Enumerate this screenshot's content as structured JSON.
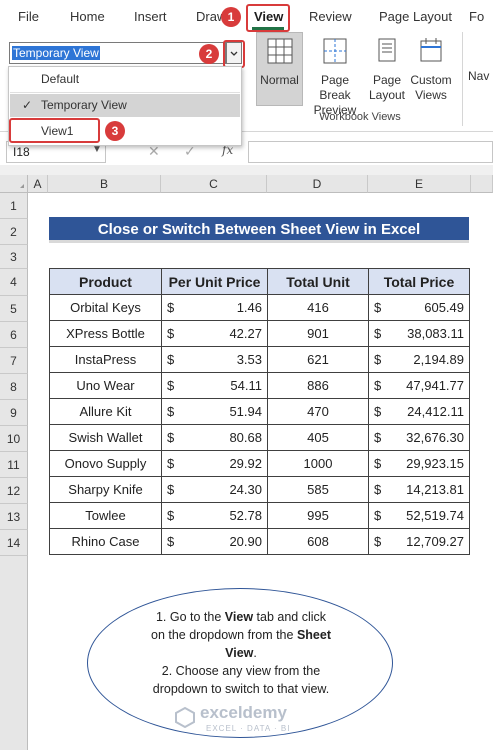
{
  "tabs": [
    "File",
    "Home",
    "Insert",
    "Draw",
    "View",
    "Review",
    "Page Layout",
    "Fo"
  ],
  "active_tab": "View",
  "ribbon": {
    "view_selector_value": "Temporary View",
    "buttons": [
      {
        "label1": "Normal",
        "label2": "",
        "icon": "normal-view-icon"
      },
      {
        "label1": "Page Break",
        "label2": "Preview",
        "icon": "page-break-preview-icon"
      },
      {
        "label1": "Page",
        "label2": "Layout",
        "icon": "page-layout-icon"
      },
      {
        "label1": "Custom",
        "label2": "Views",
        "icon": "custom-views-icon"
      },
      {
        "label1": "Nav",
        "label2": "",
        "icon": "navigation-icon"
      }
    ],
    "group_label": "Workbook Views"
  },
  "dropdown": {
    "items": [
      "Default",
      "Temporary View",
      "View1"
    ],
    "checked": "Temporary View"
  },
  "formula_bar": {
    "name_box": "I18",
    "fx": "fx"
  },
  "badges": [
    "1",
    "2",
    "3"
  ],
  "columns": [
    "A",
    "B",
    "C",
    "D",
    "E"
  ],
  "rows": [
    "1",
    "2",
    "3",
    "4",
    "5",
    "6",
    "7",
    "8",
    "9",
    "10",
    "11",
    "12",
    "13",
    "14"
  ],
  "sheet_title": "Close or Switch Between Sheet View in Excel",
  "table": {
    "headers": [
      "Product",
      "Per Unit Price",
      "Total Unit",
      "Total Price"
    ],
    "currency": "$",
    "rows": [
      [
        "Orbital Keys",
        "1.46",
        "416",
        "605.49"
      ],
      [
        "XPress Bottle",
        "42.27",
        "901",
        "38,083.11"
      ],
      [
        "InstaPress",
        "3.53",
        "621",
        "2,194.89"
      ],
      [
        "Uno Wear",
        "54.11",
        "886",
        "47,941.77"
      ],
      [
        "Allure Kit",
        "51.94",
        "470",
        "24,412.11"
      ],
      [
        "Swish Wallet",
        "80.68",
        "405",
        "32,676.30"
      ],
      [
        "Onovo Supply",
        "29.92",
        "1000",
        "29,923.15"
      ],
      [
        "Sharpy Knife",
        "24.30",
        "585",
        "14,213.81"
      ],
      [
        "Towlee",
        "52.78",
        "995",
        "52,519.74"
      ],
      [
        "Rhino Case",
        "20.90",
        "608",
        "12,709.27"
      ]
    ]
  },
  "note": {
    "line1_a": "1. Go to the ",
    "line1_b": "View",
    "line1_c": " tab and click",
    "line2_a": "on the dropdown from the ",
    "line2_b": "Sheet",
    "line3": "View",
    "line3_end": ".",
    "line4": "2. Choose any view from the",
    "line5": "dropdown to switch to that view."
  },
  "watermark": {
    "name": "exceldemy",
    "tagline": "EXCEL · DATA · BI"
  },
  "colors": {
    "title_bg": "#2f5597",
    "header_bg": "#d9e1f2",
    "badge": "#d83b3b",
    "active_tab": "#217346"
  }
}
